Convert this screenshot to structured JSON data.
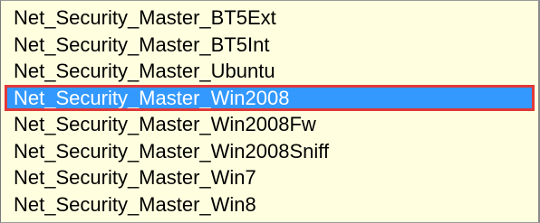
{
  "listbox": {
    "items": [
      {
        "label": "Net_Security_Master_BT5Ext",
        "selected": false
      },
      {
        "label": "Net_Security_Master_BT5Int",
        "selected": false
      },
      {
        "label": "Net_Security_Master_Ubuntu",
        "selected": false
      },
      {
        "label": "Net_Security_Master_Win2008",
        "selected": true
      },
      {
        "label": "Net_Security_Master_Win2008Fw",
        "selected": false
      },
      {
        "label": "Net_Security_Master_Win2008Sniff",
        "selected": false
      },
      {
        "label": "Net_Security_Master_Win7",
        "selected": false
      },
      {
        "label": "Net_Security_Master_Win8",
        "selected": false
      }
    ]
  },
  "colors": {
    "list_background": "#ffffe0",
    "selection_background": "#3399ff",
    "selection_highlight_border": "#e0393a",
    "text": "#000000",
    "selected_text": "#ffffff"
  }
}
